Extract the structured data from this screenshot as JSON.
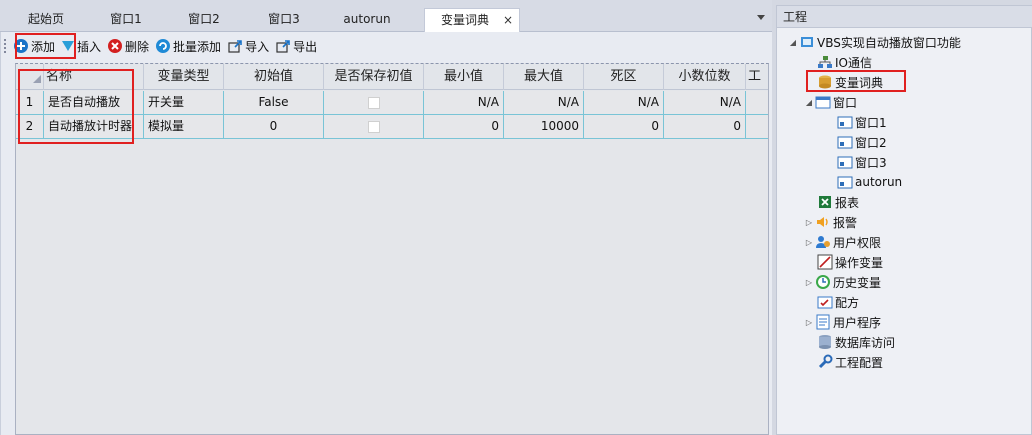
{
  "tabs": [
    {
      "label": "起始页",
      "active": false
    },
    {
      "label": "窗口1",
      "active": false
    },
    {
      "label": "窗口2",
      "active": false
    },
    {
      "label": "窗口3",
      "active": false
    },
    {
      "label": "autorun",
      "active": false
    },
    {
      "label": "变量词典",
      "active": true,
      "close": "×"
    }
  ],
  "toolbar": {
    "add": "添加",
    "insert": "插入",
    "delete": "删除",
    "batch_add": "批量添加",
    "import": "导入",
    "export": "导出"
  },
  "table": {
    "headers": [
      "名称",
      "变量类型",
      "初始值",
      "是否保存初值",
      "最小值",
      "最大值",
      "死区",
      "小数位数",
      "工"
    ],
    "rows": [
      {
        "index": "1",
        "name": "是否自动播放",
        "type": "开关量",
        "init": "False",
        "save": false,
        "min": "N/A",
        "max": "N/A",
        "dead": "N/A",
        "decimals": "N/A"
      },
      {
        "index": "2",
        "name": "自动播放计时器",
        "type": "模拟量",
        "init": "0",
        "save": false,
        "min": "0",
        "max": "10000",
        "dead": "0",
        "decimals": "0"
      }
    ]
  },
  "project": {
    "title": "工程",
    "root": "VBS实现自动播放窗口功能",
    "items": {
      "io": "IO通信",
      "dict": "变量词典",
      "window": "窗口",
      "w1": "窗口1",
      "w2": "窗口2",
      "w3": "窗口3",
      "autorun": "autorun",
      "report": "报表",
      "alarm": "报警",
      "perm": "用户权限",
      "opvar": "操作变量",
      "hist": "历史变量",
      "recipe": "配方",
      "userprog": "用户程序",
      "db": "数据库访问",
      "config": "工程配置"
    }
  },
  "colors": {
    "highlight_box": "#e02020",
    "grid_line": "#79c4d6",
    "accent_blue": "#1a73c8"
  }
}
